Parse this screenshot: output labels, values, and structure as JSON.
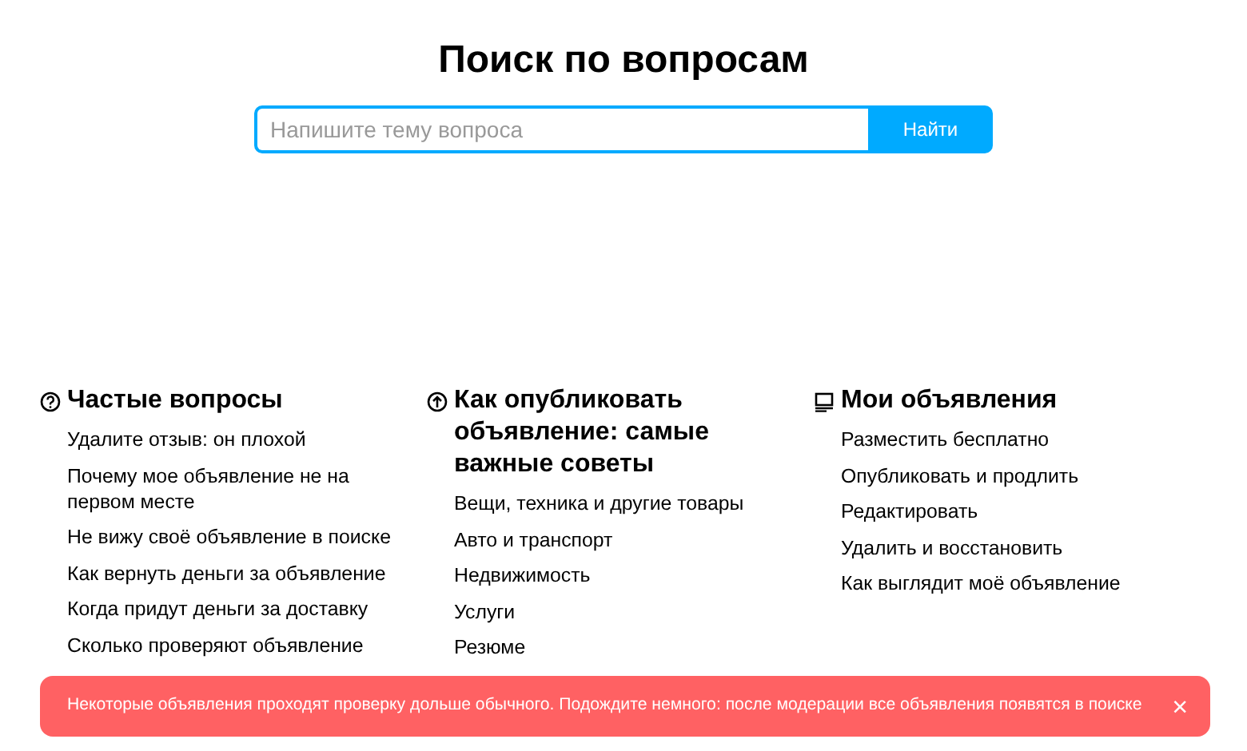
{
  "title": "Поиск по вопросам",
  "search": {
    "placeholder": "Напишите тему вопроса",
    "button": "Найти"
  },
  "sections": [
    {
      "heading": "Частые вопросы",
      "items": [
        "Удалите отзыв: он плохой",
        "Почему мое объявление не на первом месте",
        "Не вижу своё объявление в поиске",
        "Как вернуть деньги за объявление",
        "Когда придут деньги за доставку",
        "Сколько проверяют объявление"
      ]
    },
    {
      "heading": "Как опубликовать объявление: самые важные советы",
      "items": [
        "Вещи, техника и другие товары",
        "Авто и транспорт",
        "Недвижимость",
        "Услуги",
        "Резюме"
      ]
    },
    {
      "heading": "Мои объявления",
      "items": [
        "Разместить бесплатно",
        "Опубликовать и продлить",
        "Редактировать",
        "Удалить и восстановить",
        "Как выглядит моё объявление"
      ]
    }
  ],
  "toast": {
    "message": "Некоторые объявления проходят проверку дольше обычного. Подождите немного: после модерации все объявления появятся в поиске",
    "close": "×"
  }
}
